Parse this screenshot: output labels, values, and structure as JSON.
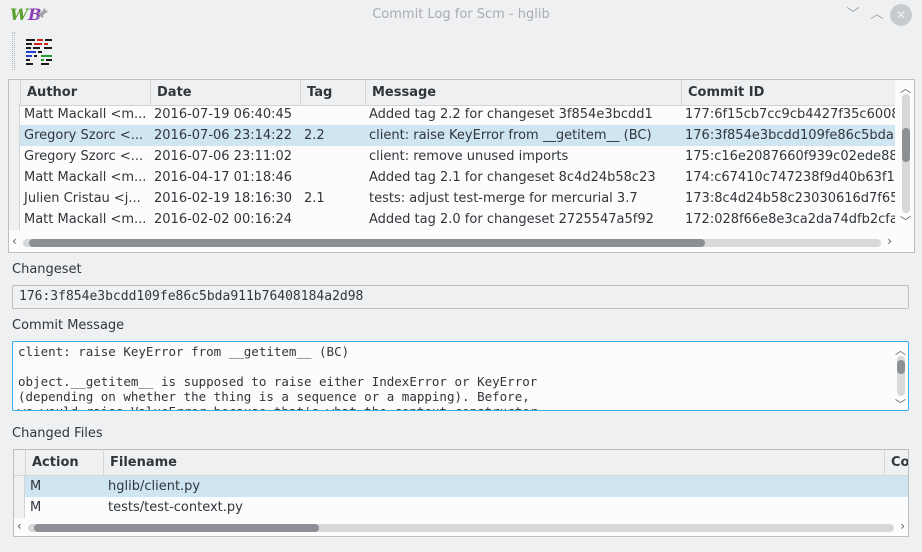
{
  "window": {
    "title": "Commit Log for Scm - hglib",
    "logo_w": "W",
    "logo_b": "B",
    "pin_icon": "pin-icon",
    "minimize_glyph": "﹀",
    "maximize_glyph": "︿",
    "close_glyph": "✕"
  },
  "toolbar": {
    "diff_icon": "diff-icon"
  },
  "log": {
    "columns": [
      "Author",
      "Date",
      "Tag",
      "Message",
      "Commit ID"
    ],
    "rows": [
      {
        "author": "Matt Mackall <m...",
        "date": "2016-07-19 06:40:45",
        "tag": "",
        "message": "Added tag 2.2 for changeset 3f854e3bcdd1",
        "commit": "177:6f15cb7cc9cb4427f35c6008"
      },
      {
        "author": "Gregory Szorc <...",
        "date": "2016-07-06 23:14:22",
        "tag": "2.2",
        "message": "client: raise KeyError from __getitem__ (BC)",
        "commit": "176:3f854e3bcdd109fe86c5bda",
        "selected": true
      },
      {
        "author": "Gregory Szorc <...",
        "date": "2016-07-06 23:11:02",
        "tag": "",
        "message": "client: remove unused imports",
        "commit": "175:c16e2087660f939c02ede88"
      },
      {
        "author": "Matt Mackall <m...",
        "date": "2016-04-17 01:18:46",
        "tag": "",
        "message": "Added tag 2.1 for changeset 8c4d24b58c23",
        "commit": "174:c67410c747238f9d40b63f1"
      },
      {
        "author": "Julien Cristau <j...",
        "date": "2016-02-19 18:16:30",
        "tag": "2.1",
        "message": "tests: adjust test-merge for mercurial 3.7",
        "commit": "173:8c4d24b58c23030616d7f65"
      },
      {
        "author": "Matt Mackall <m...",
        "date": "2016-02-02 00:16:24",
        "tag": "",
        "message": "Added tag 2.0 for changeset 2725547a5f92",
        "commit": "172:028f66e8e3ca2da74dfb2cfa"
      }
    ]
  },
  "changeset": {
    "label": "Changeset",
    "value": "176:3f854e3bcdd109fe86c5bda911b76408184a2d98"
  },
  "commit_message": {
    "label": "Commit Message",
    "text": "client: raise KeyError from __getitem__ (BC)\n\nobject.__getitem__ is supposed to raise either IndexError or KeyError\n(depending on whether the thing is a sequence or a mapping). Before,\nwe would raise ValueError because that's what the context constructor"
  },
  "changed_files": {
    "label": "Changed Files",
    "columns": [
      "Action",
      "Filename",
      "Co"
    ],
    "rows": [
      {
        "action": "M",
        "filename": "hglib/client.py",
        "selected": true
      },
      {
        "action": "M",
        "filename": "tests/test-context.py"
      }
    ]
  },
  "colors": {
    "selection": "#cfe5f1",
    "focus": "#3daee9",
    "background": "#eff0f1"
  }
}
